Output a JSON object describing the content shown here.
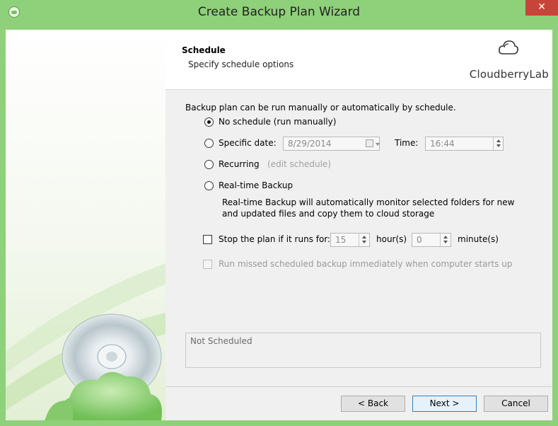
{
  "window": {
    "title": "Create Backup Plan Wizard",
    "close_glyph": "✕",
    "accent_color": "#8fd07a"
  },
  "header": {
    "title": "Schedule",
    "subtitle": "Specify schedule options",
    "brand": "CloudberryLab"
  },
  "main": {
    "intro": "Backup plan can be run manually or automatically by schedule.",
    "options": {
      "no_schedule": {
        "label": "No schedule (run manually)",
        "selected": true
      },
      "specific_date": {
        "label": "Specific date:",
        "date_value": "8/29/2014",
        "time_label": "Time:",
        "time_value": "16:44"
      },
      "recurring": {
        "label": "Recurring",
        "link": "(edit schedule)"
      },
      "realtime": {
        "label": "Real-time Backup",
        "description_line1": "Real-time Backup will automatically monitor selected folders for new",
        "description_line2": "and updated files and copy them to cloud storage"
      }
    },
    "stop_plan": {
      "label": "Stop the plan if it runs for:",
      "hours_value": "15",
      "hours_unit": "hour(s)",
      "minutes_value": "0",
      "minutes_unit": "minute(s)",
      "checked": false
    },
    "run_missed": {
      "label": "Run missed scheduled backup immediately when computer starts up",
      "checked": false,
      "enabled": false
    },
    "status": "Not Scheduled"
  },
  "footer": {
    "back": "< Back",
    "next": "Next >",
    "cancel": "Cancel"
  }
}
